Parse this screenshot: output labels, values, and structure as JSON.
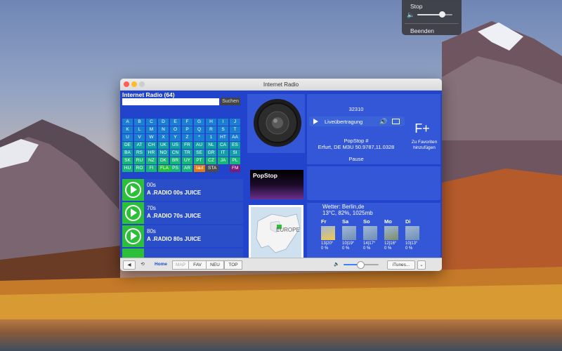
{
  "menu": {
    "stop_label": "Stop",
    "quit_label": "Beenden",
    "volume": 0.7
  },
  "window": {
    "title": "Internet Radio"
  },
  "app": {
    "title": "Internet Radio (64)"
  },
  "search": {
    "placeholder": "",
    "button_label": "Suchen"
  },
  "letters": [
    [
      "A",
      "B",
      "C",
      "D",
      "E",
      "F",
      "G",
      "H",
      "I",
      "J"
    ],
    [
      "K",
      "L",
      "M",
      "N",
      "O",
      "P",
      "Q",
      "R",
      "S",
      "T"
    ],
    [
      "U",
      "V",
      "W",
      "X",
      "Y",
      "Z",
      "*",
      "1",
      "HT",
      "AA"
    ]
  ],
  "countries": [
    [
      "DE",
      "AT",
      "CH",
      "UK",
      "US",
      "FR",
      "AU",
      "NL",
      "CA",
      "ES"
    ],
    [
      "BA",
      "RS",
      "HR",
      "NO",
      "CN",
      "TR",
      "SE",
      "GR",
      "IT",
      "SI"
    ],
    [
      "SK",
      "RU",
      "NZ",
      "DK",
      "BR",
      "UY",
      "PT",
      "CZ",
      "JA",
      "PL"
    ],
    [
      "HU",
      "RO",
      "FI",
      "IL",
      "PS",
      "AR"
    ]
  ],
  "flags": {
    "fla": "FLA",
    "laut": "laut",
    "sta": "STA",
    "fm": "FM"
  },
  "stations": [
    {
      "name": "00s",
      "desc": "A .RADIO 00s JUICE"
    },
    {
      "name": "70s",
      "desc": "A .RADIO 70s JUICE"
    },
    {
      "name": "80s",
      "desc": "A .RADIO 80s JUICE"
    }
  ],
  "player": {
    "number": "32310",
    "live_label": "Liveübertragung",
    "station_line1": "PopStop #",
    "station_line2": "Erfurt, DE M3U 50.9787,11.0328",
    "status": "Pause",
    "logo_text": "PopStop"
  },
  "favorite": {
    "icon_text": "F+",
    "label": "Zu Favoriten hinzufügen"
  },
  "map": {
    "label": "EUROPE"
  },
  "weather": {
    "header": "Wetter: Berlin,de",
    "current": "13°C, 82%, 1025mb",
    "days": [
      {
        "day": "Fr",
        "temp": "13|20°",
        "rain": "0 %",
        "icon": "sun-icon"
      },
      {
        "day": "Sa",
        "temp": "10|19°",
        "rain": "0 %",
        "icon": "rain-icon"
      },
      {
        "day": "So",
        "temp": "14|17°",
        "rain": "0 %",
        "icon": "rain-icon"
      },
      {
        "day": "Mo",
        "temp": "12|16°",
        "rain": "0 %",
        "icon": "storm-icon"
      },
      {
        "day": "Di",
        "temp": "10|13°",
        "rain": "0 %",
        "icon": "rain-icon"
      }
    ]
  },
  "toolbar": {
    "home_label": "Home",
    "map_label": "MAP",
    "fav_label": "FAV",
    "neu_label": "NEU",
    "top_label": "TOP",
    "itunes_label": "iTunes...",
    "volume": 0.45
  },
  "colors": {
    "panel": "#2244cc",
    "play": "#2bbf3a",
    "accent": "#3b82f6"
  }
}
